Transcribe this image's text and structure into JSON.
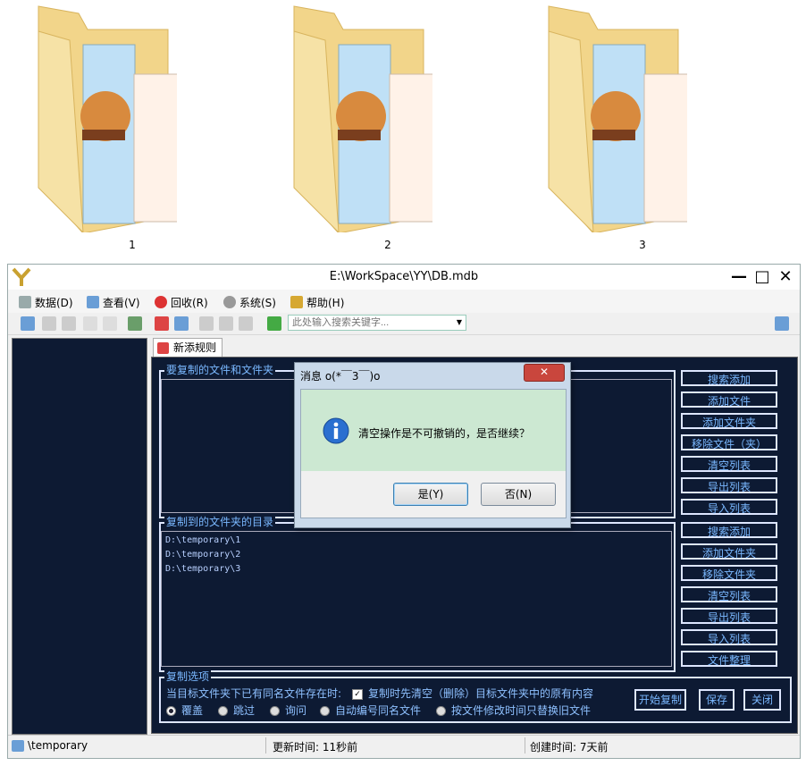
{
  "desktop": {
    "folders": [
      {
        "label": "1"
      },
      {
        "label": "2"
      },
      {
        "label": "3"
      }
    ]
  },
  "window": {
    "title": "E:\\WorkSpace\\YY\\DB.mdb",
    "minimize": "—",
    "maximize": "□",
    "close": "✕"
  },
  "menu": {
    "items": [
      {
        "label": "数据(D)",
        "icon": "database-icon"
      },
      {
        "label": "查看(V)",
        "icon": "grid-view-icon"
      },
      {
        "label": "回收(R)",
        "icon": "recycle-icon"
      },
      {
        "label": "系统(S)",
        "icon": "gear-icon"
      },
      {
        "label": "帮助(H)",
        "icon": "help-icon"
      }
    ]
  },
  "toolbar": {
    "search_placeholder": "此处输入搜索关键字..."
  },
  "tab": {
    "label": "新添规则"
  },
  "sources": {
    "title": "要复制的文件和文件夹",
    "buttons": [
      "搜索添加",
      "添加文件",
      "添加文件夹",
      "移除文件（夹）",
      "清空列表",
      "导出列表",
      "导入列表"
    ]
  },
  "targets": {
    "title": "复制到的文件夹的目录",
    "paths": [
      "D:\\temporary\\1",
      "D:\\temporary\\2",
      "D:\\temporary\\3"
    ],
    "buttons": [
      "搜索添加",
      "添加文件夹",
      "移除文件夹",
      "清空列表",
      "导出列表",
      "导入列表",
      "文件整理"
    ]
  },
  "options": {
    "title": "复制选项",
    "conflict_label": "当目标文件夹下已有同名文件存在时:",
    "clear_first": "复制时先清空（删除）目标文件夹中的原有内容",
    "radios": [
      "覆盖",
      "跳过",
      "询问",
      "自动编号同名文件",
      "按文件修改时间只替换旧文件"
    ],
    "selected": "覆盖",
    "start": "开始复制",
    "save": "保存",
    "close": "关闭"
  },
  "status": {
    "path": "\\temporary",
    "updated": "更新时间: 11秒前",
    "created": "创建时间: 7天前"
  },
  "dialog": {
    "title": "消息 o(*￣3￣)o",
    "close": "✕",
    "message": "清空操作是不可撤销的，是否继续？",
    "yes": "是(Y)",
    "no": "否(N)"
  },
  "colors": {
    "panel_bg": "#0d1a33",
    "accent_text": "#7ab8ff",
    "dialog_body": "#cce8d2"
  }
}
